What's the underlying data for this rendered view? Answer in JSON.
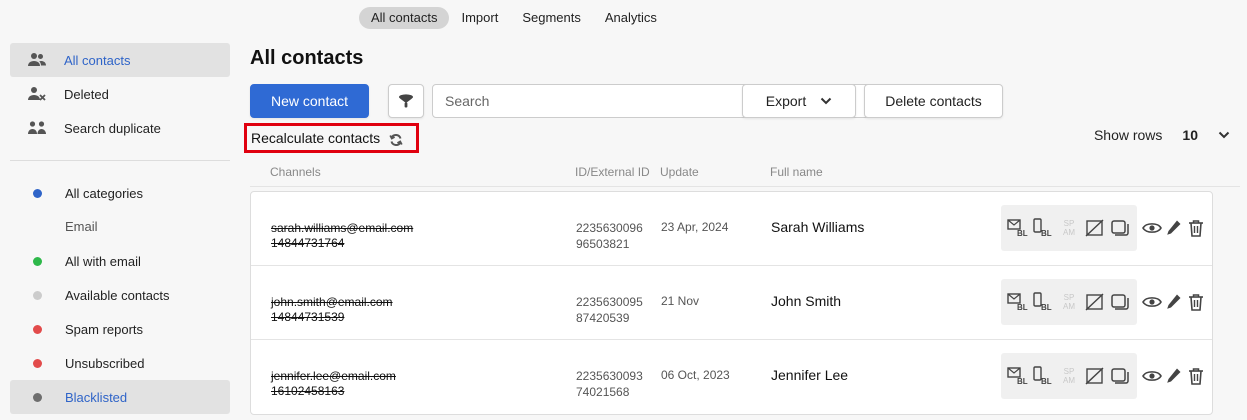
{
  "topnav": {
    "tabs": [
      {
        "label": "All contacts",
        "active": true
      },
      {
        "label": "Import",
        "active": false
      },
      {
        "label": "Segments",
        "active": false
      },
      {
        "label": "Analytics",
        "active": false
      }
    ]
  },
  "sidebar": {
    "items": [
      {
        "label": "All contacts",
        "icon": "users-icon"
      },
      {
        "label": "Deleted",
        "icon": "user-remove-icon"
      },
      {
        "label": "Search duplicate",
        "icon": "duplicate-users-icon"
      }
    ],
    "categories": [
      {
        "label": "All categories",
        "color": "#2f64c8"
      }
    ],
    "group_label": "Email",
    "email_categories": [
      {
        "label": "All with email",
        "color": "#2eb84a"
      },
      {
        "label": "Available contacts",
        "color": "#cccccc"
      },
      {
        "label": "Spam reports",
        "color": "#e24b4b"
      },
      {
        "label": "Unsubscribed",
        "color": "#e24b4b"
      },
      {
        "label": "Blacklisted",
        "color": "#6e6e6e"
      }
    ]
  },
  "main": {
    "title": "All contacts",
    "new_contact_label": "New contact",
    "search_placeholder": "Search",
    "export_label": "Export",
    "delete_contacts_label": "Delete contacts",
    "recalculate_label": "Recalculate contacts",
    "show_rows_label": "Show rows",
    "show_rows_value": "10",
    "columns": {
      "channels": "Channels",
      "id": "ID/External ID",
      "update": "Update",
      "full_name": "Full name"
    },
    "rows": [
      {
        "email": "sarah.williams@email.com",
        "phone": "14844731764",
        "id": "2235630096",
        "external_id": "96503821",
        "update": "23 Apr, 2024",
        "full_name": "Sarah Williams"
      },
      {
        "email": "john.smith@email.com",
        "phone": "14844731539",
        "id": "2235630095",
        "external_id": "87420539",
        "update": "21 Nov",
        "full_name": "John Smith"
      },
      {
        "email": "jennifer.lee@email.com",
        "phone": "16102458163",
        "id": "2235630093",
        "external_id": "74021568",
        "update": "06 Oct, 2023",
        "full_name": "Jennifer Lee"
      }
    ],
    "spam_badge": "SP AM",
    "bl_badge": "BL",
    "accent_color": "#2f6ad4",
    "highlight_color": "#e0000f"
  }
}
